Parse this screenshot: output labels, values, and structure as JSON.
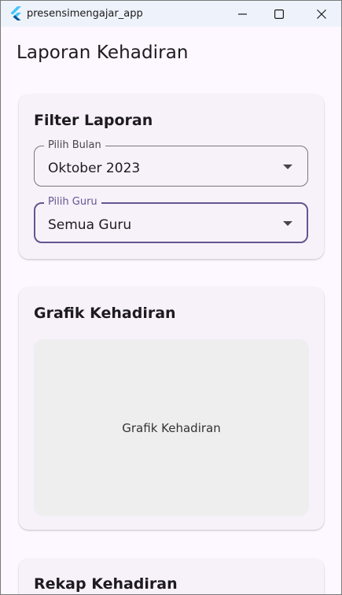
{
  "window": {
    "title": "presensimengajar_app",
    "buttons": [
      "minimize-icon",
      "maximize-icon",
      "close-icon"
    ]
  },
  "appbar": {
    "title": "Laporan Kehadiran"
  },
  "filter_card": {
    "title": "Filter Laporan",
    "bulan_field": {
      "label": "Pilih Bulan",
      "value": "Oktober 2023"
    },
    "guru_field": {
      "label": "Pilih Guru",
      "value": "Semua Guru",
      "focused": true
    }
  },
  "chart_card": {
    "title": "Grafik Kehadiran",
    "placeholder": "Grafik Kehadiran"
  },
  "rekap_card": {
    "title": "Rekap Kehadiran"
  },
  "colors": {
    "background": "#fdf7ff",
    "card": "#f7f2fa",
    "focus": "#65558f",
    "outline": "#79747e",
    "chart_placeholder": "#eeeeee",
    "titlebar": "#eef3fb"
  }
}
